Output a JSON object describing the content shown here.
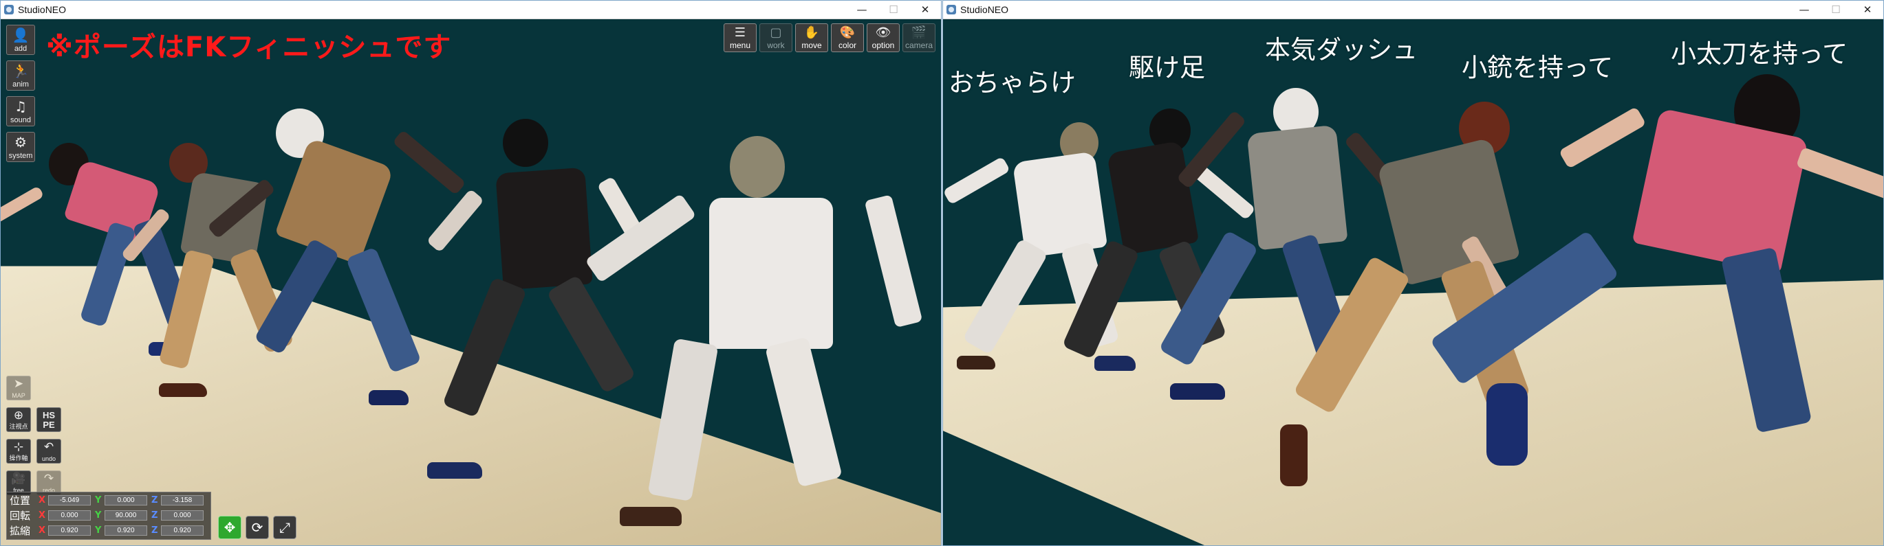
{
  "left_window": {
    "title": "StudioNEO",
    "controls": {
      "minimize": "—",
      "maximize": "☐",
      "close": "✕"
    },
    "headline": "※ポーズはFKフィニッシュです",
    "left_tools": [
      {
        "label": "add",
        "icon": "person-add-icon",
        "glyph": "👤"
      },
      {
        "label": "anim",
        "icon": "run-icon",
        "glyph": "🏃"
      },
      {
        "label": "sound",
        "icon": "music-icon",
        "glyph": "♫"
      },
      {
        "label": "system",
        "icon": "gears-icon",
        "glyph": "⚙"
      }
    ],
    "top_tools": [
      {
        "label": "menu",
        "icon": "menu-list-icon",
        "glyph": "☰",
        "enabled": true
      },
      {
        "label": "work",
        "icon": "work-panel-icon",
        "glyph": "▢",
        "enabled": false
      },
      {
        "label": "move",
        "icon": "hand-icon",
        "glyph": "✋",
        "enabled": true
      },
      {
        "label": "color",
        "icon": "palette-icon",
        "glyph": "🎨",
        "enabled": true
      },
      {
        "label": "option",
        "icon": "eye-icon",
        "glyph": "👁",
        "enabled": true
      },
      {
        "label": "camera",
        "icon": "clapper-icon",
        "glyph": "🎬",
        "enabled": false
      }
    ],
    "small_tools": {
      "map": {
        "label": "MAP",
        "icon": "cursor-icon",
        "glyph": "➤",
        "enabled": false
      },
      "init_pos": {
        "label": "注視点",
        "icon": "crosshair-icon",
        "glyph": "⊕",
        "enabled": true
      },
      "hspe": {
        "text": "HS PE"
      },
      "op_panel": {
        "label": "操作軸",
        "icon": "axis-icon",
        "glyph": "⊹",
        "enabled": true
      },
      "undo": {
        "label": "undo",
        "icon": "undo-icon",
        "glyph": "↶",
        "enabled": true
      },
      "free": {
        "label": "free",
        "icon": "video-camera-icon",
        "glyph": "🎥",
        "enabled": true
      },
      "redo": {
        "label": "redo",
        "icon": "redo-icon",
        "glyph": "↷",
        "enabled": false
      }
    },
    "transform": {
      "rows": [
        {
          "name": "位置",
          "x": "-5.049",
          "y": "0.000",
          "z": "-3.158"
        },
        {
          "name": "回転",
          "x": "0.000",
          "y": "90.000",
          "z": "0.000"
        },
        {
          "name": "拡縮",
          "x": "0.920",
          "y": "0.920",
          "z": "0.920"
        }
      ],
      "axis_labels": {
        "x": "X",
        "y": "Y",
        "z": "Z"
      }
    },
    "gizmos": [
      {
        "name": "move-gizmo",
        "icon": "move-arrows-icon",
        "glyph": "✥"
      },
      {
        "name": "rotate-gizmo",
        "icon": "rotate-icon",
        "glyph": "⟳"
      },
      {
        "name": "scale-gizmo",
        "icon": "scale-icon",
        "glyph": "⤢"
      }
    ]
  },
  "right_window": {
    "title": "StudioNEO",
    "controls": {
      "minimize": "—",
      "maximize": "☐",
      "close": "✕"
    },
    "captions": [
      "おちゃらけ",
      "駆け足",
      "本気ダッシュ",
      "小銃を持って",
      "小太刀を持って"
    ]
  },
  "colors": {
    "background": "#07343a",
    "floor": "#d9cba6",
    "headline": "#ff1a1a"
  }
}
